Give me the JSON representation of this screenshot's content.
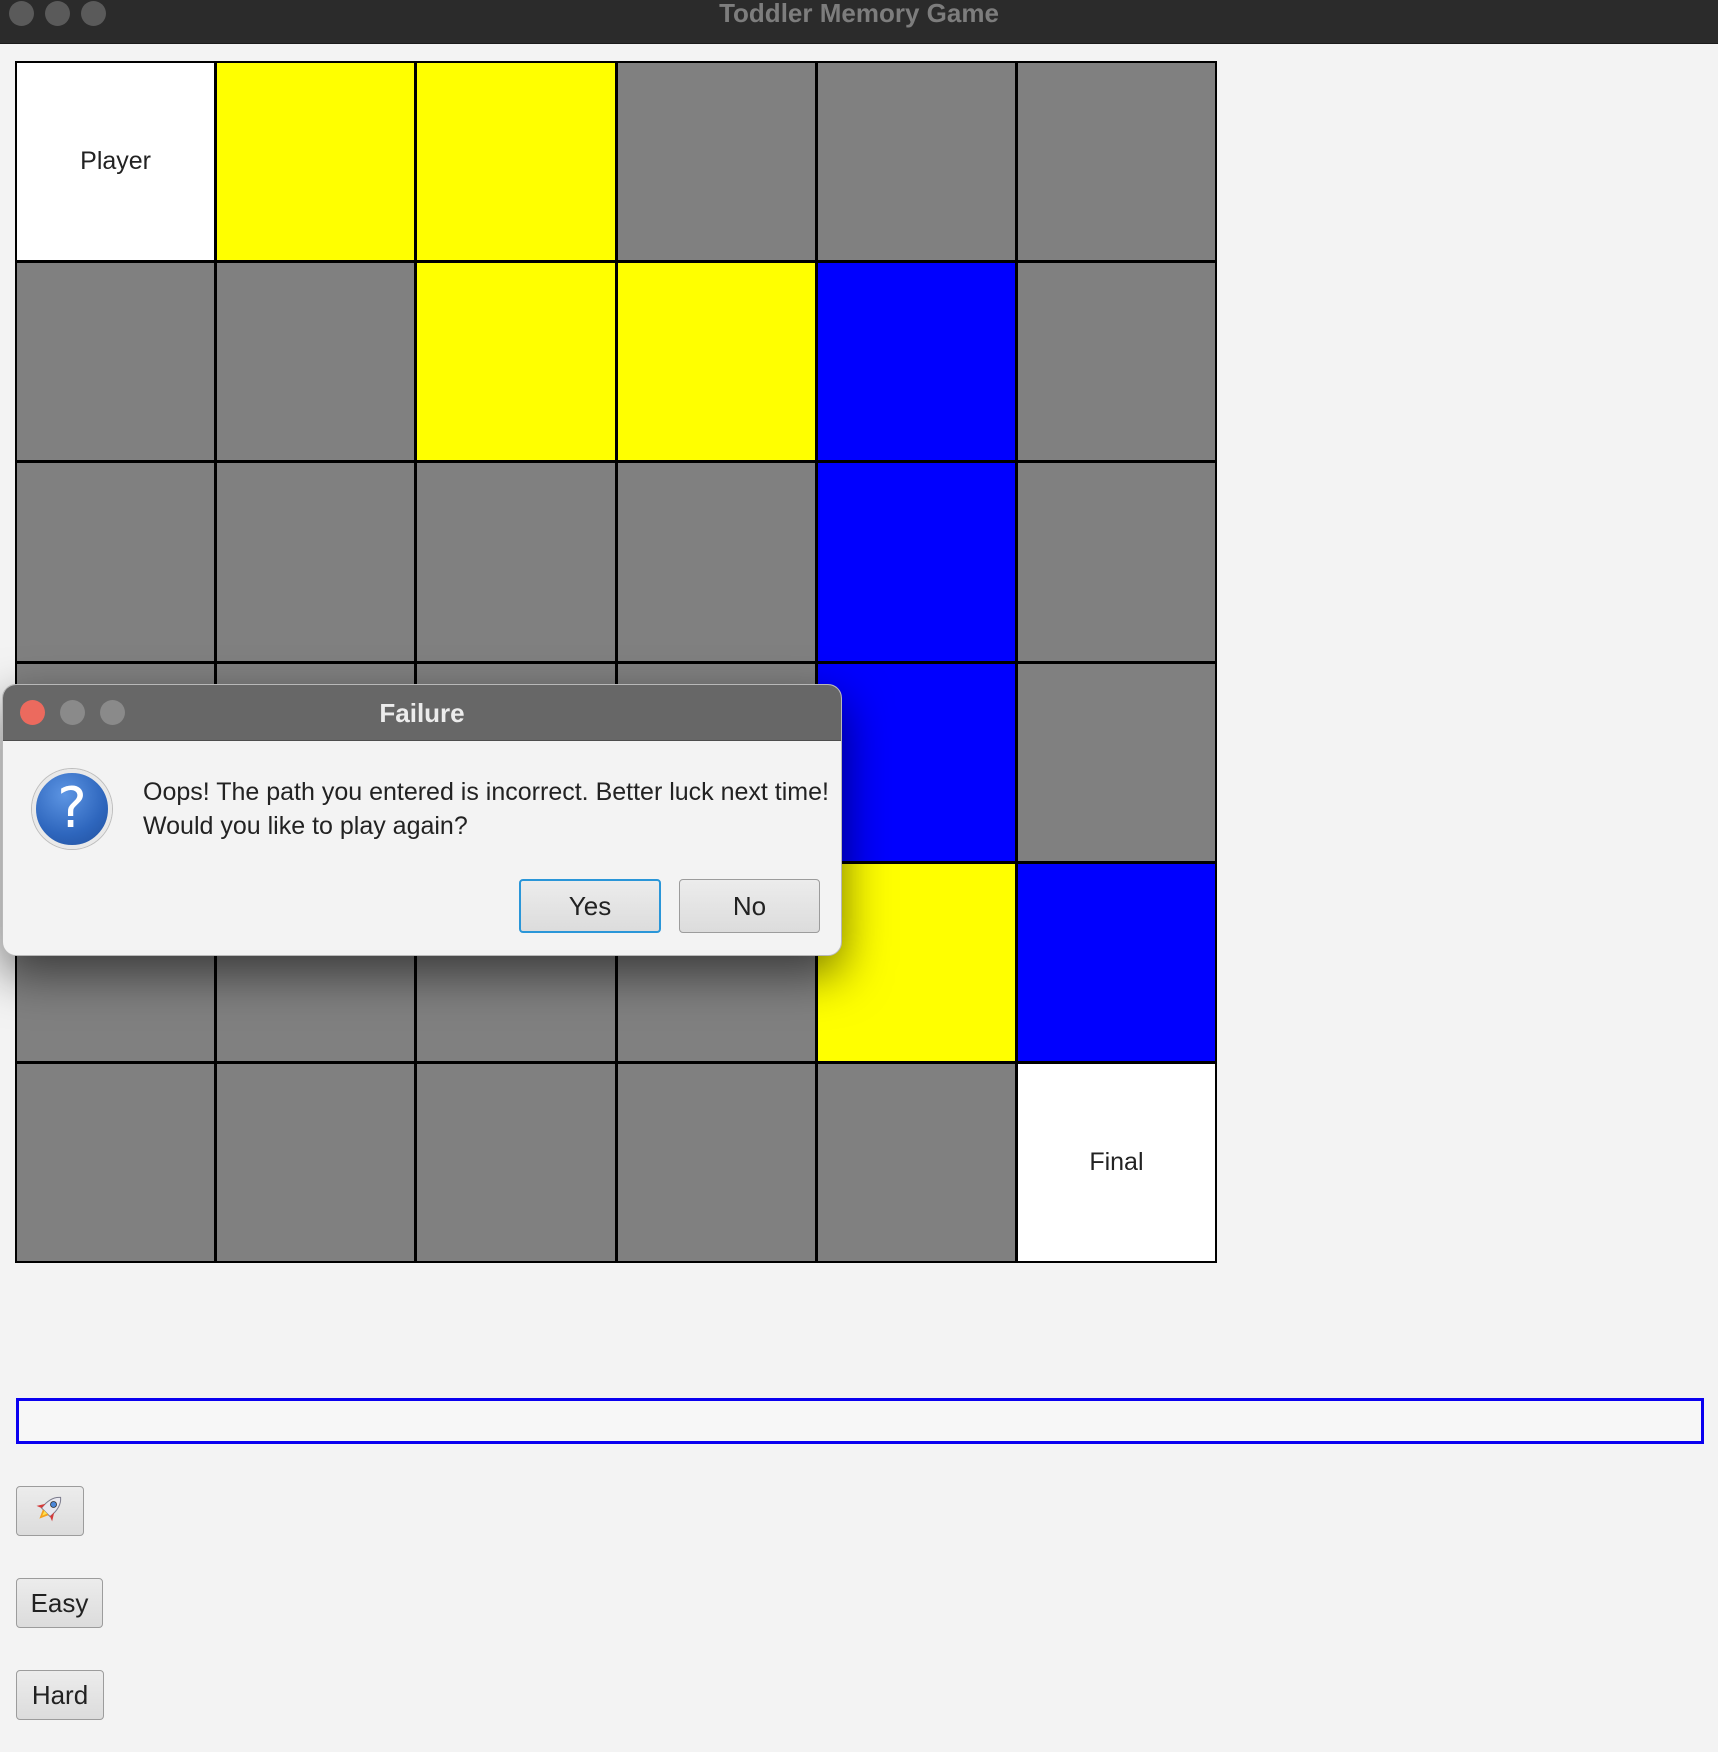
{
  "window": {
    "title": "Toddler Memory Game"
  },
  "board": {
    "rows": 6,
    "cols": 6,
    "colors": {
      "start": "#ffffff",
      "path_yellow": "#ffff00",
      "path_blue": "#0000ff",
      "empty": "#808080"
    },
    "cells": [
      [
        "start",
        "path_yellow",
        "path_yellow",
        "empty",
        "empty",
        "empty"
      ],
      [
        "empty",
        "empty",
        "path_yellow",
        "path_yellow",
        "path_blue",
        "empty"
      ],
      [
        "empty",
        "empty",
        "empty",
        "empty",
        "path_blue",
        "empty"
      ],
      [
        "empty",
        "empty",
        "empty",
        "empty",
        "path_blue",
        "empty"
      ],
      [
        "empty",
        "empty",
        "empty",
        "empty",
        "path_yellow",
        "path_blue"
      ],
      [
        "empty",
        "empty",
        "empty",
        "empty",
        "empty",
        "start"
      ]
    ],
    "start_label": "Player",
    "final_label": "Final"
  },
  "path_input": {
    "value": "",
    "placeholder": ""
  },
  "controls": {
    "rocket_icon": "rocket-icon",
    "easy_label": "Easy",
    "hard_label": "Hard"
  },
  "dialog": {
    "title": "Failure",
    "icon": "question-icon",
    "message_line1": "Oops! The path you entered is incorrect. Better luck next time!",
    "message_line2": "Would you like to play again?",
    "yes_label": "Yes",
    "no_label": "No"
  }
}
